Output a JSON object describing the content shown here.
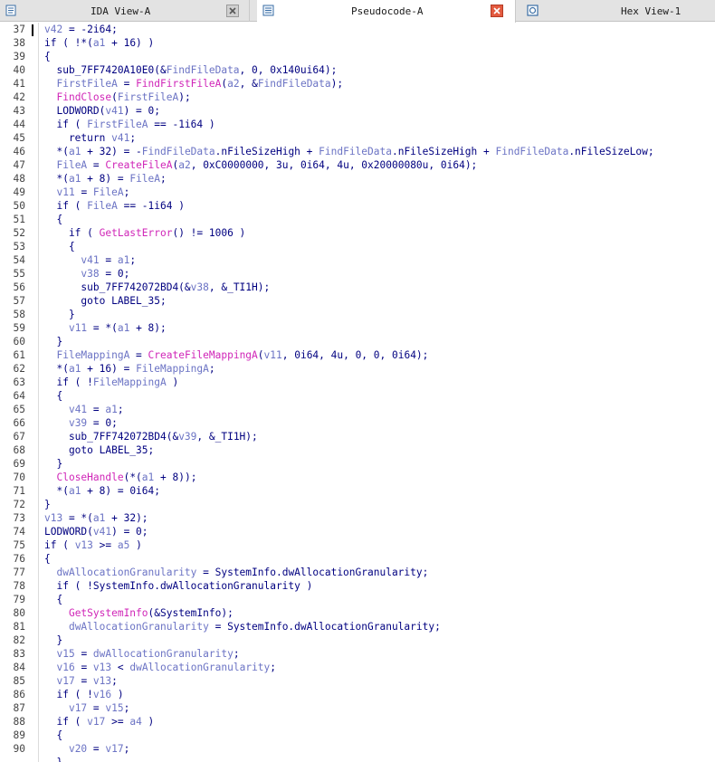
{
  "tabs": [
    {
      "id": "ida-view",
      "label": "IDA View-A",
      "icon": "ida-view-icon",
      "active": false
    },
    {
      "id": "pseudocode",
      "label": "Pseudocode-A",
      "icon": "pseudocode-icon",
      "active": true
    },
    {
      "id": "hex-view",
      "label": "Hex View-1",
      "icon": "hex-view-icon",
      "active": false
    }
  ],
  "colors": {
    "default": "#000080",
    "variable": "#6b73c4",
    "function": "#d026b8",
    "line_number": "#444444",
    "close_active": "#e35a3f"
  },
  "code_lines": [
    {
      "n": "37",
      "tokens": [
        [
          "v",
          "v42"
        ],
        [
          "o",
          " = -2i64;"
        ]
      ]
    },
    {
      "n": "38",
      "tokens": [
        [
          "o",
          "if ( !*("
        ],
        [
          "v",
          "a1"
        ],
        [
          "o",
          " + 16) )"
        ]
      ]
    },
    {
      "n": "39",
      "tokens": [
        [
          "o",
          "{"
        ]
      ]
    },
    {
      "n": "40",
      "tokens": [
        [
          "o",
          "  sub_7FF7420A10E0(&"
        ],
        [
          "v",
          "FindFileData"
        ],
        [
          "o",
          ", 0, 0x140ui64);"
        ]
      ]
    },
    {
      "n": "41",
      "tokens": [
        [
          "o",
          "  "
        ],
        [
          "v",
          "FirstFileA"
        ],
        [
          "o",
          " = "
        ],
        [
          "f",
          "FindFirstFileA"
        ],
        [
          "o",
          "("
        ],
        [
          "v",
          "a2"
        ],
        [
          "o",
          ", &"
        ],
        [
          "v",
          "FindFileData"
        ],
        [
          "o",
          ");"
        ]
      ]
    },
    {
      "n": "42",
      "tokens": [
        [
          "o",
          "  "
        ],
        [
          "f",
          "FindClose"
        ],
        [
          "o",
          "("
        ],
        [
          "v",
          "FirstFileA"
        ],
        [
          "o",
          ");"
        ]
      ]
    },
    {
      "n": "43",
      "tokens": [
        [
          "o",
          "  LODWORD("
        ],
        [
          "v",
          "v41"
        ],
        [
          "o",
          ") = 0;"
        ]
      ]
    },
    {
      "n": "44",
      "tokens": [
        [
          "o",
          "  if ( "
        ],
        [
          "v",
          "FirstFileA"
        ],
        [
          "o",
          " == -1i64 )"
        ]
      ]
    },
    {
      "n": "45",
      "tokens": [
        [
          "o",
          "    return "
        ],
        [
          "v",
          "v41"
        ],
        [
          "o",
          ";"
        ]
      ]
    },
    {
      "n": "46",
      "tokens": [
        [
          "o",
          "  *("
        ],
        [
          "v",
          "a1"
        ],
        [
          "o",
          " + 32) = -"
        ],
        [
          "v",
          "FindFileData"
        ],
        [
          "o",
          ".nFileSizeHigh + "
        ],
        [
          "v",
          "FindFileData"
        ],
        [
          "o",
          ".nFileSizeHigh + "
        ],
        [
          "v",
          "FindFileData"
        ],
        [
          "o",
          ".nFileSizeLow;"
        ]
      ]
    },
    {
      "n": "47",
      "tokens": [
        [
          "o",
          "  "
        ],
        [
          "v",
          "FileA"
        ],
        [
          "o",
          " = "
        ],
        [
          "f",
          "CreateFileA"
        ],
        [
          "o",
          "("
        ],
        [
          "v",
          "a2"
        ],
        [
          "o",
          ", 0xC0000000, 3u, 0i64, 4u, 0x20000080u, 0i64);"
        ]
      ]
    },
    {
      "n": "48",
      "tokens": [
        [
          "o",
          "  *("
        ],
        [
          "v",
          "a1"
        ],
        [
          "o",
          " + 8) = "
        ],
        [
          "v",
          "FileA"
        ],
        [
          "o",
          ";"
        ]
      ]
    },
    {
      "n": "49",
      "tokens": [
        [
          "o",
          "  "
        ],
        [
          "v",
          "v11"
        ],
        [
          "o",
          " = "
        ],
        [
          "v",
          "FileA"
        ],
        [
          "o",
          ";"
        ]
      ]
    },
    {
      "n": "50",
      "tokens": [
        [
          "o",
          "  if ( "
        ],
        [
          "v",
          "FileA"
        ],
        [
          "o",
          " == -1i64 )"
        ]
      ]
    },
    {
      "n": "51",
      "tokens": [
        [
          "o",
          "  {"
        ]
      ]
    },
    {
      "n": "52",
      "tokens": [
        [
          "o",
          "    if ( "
        ],
        [
          "f",
          "GetLastError"
        ],
        [
          "o",
          "() != 1006 )"
        ]
      ]
    },
    {
      "n": "53",
      "tokens": [
        [
          "o",
          "    {"
        ]
      ]
    },
    {
      "n": "54",
      "tokens": [
        [
          "o",
          "      "
        ],
        [
          "v",
          "v41"
        ],
        [
          "o",
          " = "
        ],
        [
          "v",
          "a1"
        ],
        [
          "o",
          ";"
        ]
      ]
    },
    {
      "n": "55",
      "tokens": [
        [
          "o",
          "      "
        ],
        [
          "v",
          "v38"
        ],
        [
          "o",
          " = 0;"
        ]
      ]
    },
    {
      "n": "56",
      "tokens": [
        [
          "o",
          "      sub_7FF742072BD4(&"
        ],
        [
          "v",
          "v38"
        ],
        [
          "o",
          ", &_TI1H);"
        ]
      ]
    },
    {
      "n": "57",
      "tokens": [
        [
          "o",
          "      goto LABEL_35;"
        ]
      ]
    },
    {
      "n": "58",
      "tokens": [
        [
          "o",
          "    }"
        ]
      ]
    },
    {
      "n": "59",
      "tokens": [
        [
          "o",
          "    "
        ],
        [
          "v",
          "v11"
        ],
        [
          "o",
          " = *("
        ],
        [
          "v",
          "a1"
        ],
        [
          "o",
          " + 8);"
        ]
      ]
    },
    {
      "n": "60",
      "tokens": [
        [
          "o",
          "  }"
        ]
      ]
    },
    {
      "n": "61",
      "tokens": [
        [
          "o",
          "  "
        ],
        [
          "v",
          "FileMappingA"
        ],
        [
          "o",
          " = "
        ],
        [
          "f",
          "CreateFileMappingA"
        ],
        [
          "o",
          "("
        ],
        [
          "v",
          "v11"
        ],
        [
          "o",
          ", 0i64, 4u, 0, 0, 0i64);"
        ]
      ]
    },
    {
      "n": "62",
      "tokens": [
        [
          "o",
          "  *("
        ],
        [
          "v",
          "a1"
        ],
        [
          "o",
          " + 16) = "
        ],
        [
          "v",
          "FileMappingA"
        ],
        [
          "o",
          ";"
        ]
      ]
    },
    {
      "n": "63",
      "tokens": [
        [
          "o",
          "  if ( !"
        ],
        [
          "v",
          "FileMappingA"
        ],
        [
          "o",
          " )"
        ]
      ]
    },
    {
      "n": "64",
      "tokens": [
        [
          "o",
          "  {"
        ]
      ]
    },
    {
      "n": "65",
      "tokens": [
        [
          "o",
          "    "
        ],
        [
          "v",
          "v41"
        ],
        [
          "o",
          " = "
        ],
        [
          "v",
          "a1"
        ],
        [
          "o",
          ";"
        ]
      ]
    },
    {
      "n": "66",
      "tokens": [
        [
          "o",
          "    "
        ],
        [
          "v",
          "v39"
        ],
        [
          "o",
          " = 0;"
        ]
      ]
    },
    {
      "n": "67",
      "tokens": [
        [
          "o",
          "    sub_7FF742072BD4(&"
        ],
        [
          "v",
          "v39"
        ],
        [
          "o",
          ", &_TI1H);"
        ]
      ]
    },
    {
      "n": "68",
      "tokens": [
        [
          "o",
          "    goto LABEL_35;"
        ]
      ]
    },
    {
      "n": "69",
      "tokens": [
        [
          "o",
          "  }"
        ]
      ]
    },
    {
      "n": "70",
      "tokens": [
        [
          "o",
          "  "
        ],
        [
          "f",
          "CloseHandle"
        ],
        [
          "o",
          "(*("
        ],
        [
          "v",
          "a1"
        ],
        [
          "o",
          " + 8));"
        ]
      ]
    },
    {
      "n": "71",
      "tokens": [
        [
          "o",
          "  *("
        ],
        [
          "v",
          "a1"
        ],
        [
          "o",
          " + 8) = 0i64;"
        ]
      ]
    },
    {
      "n": "72",
      "tokens": [
        [
          "o",
          "}"
        ]
      ]
    },
    {
      "n": "73",
      "tokens": [
        [
          "v",
          "v13"
        ],
        [
          "o",
          " = *("
        ],
        [
          "v",
          "a1"
        ],
        [
          "o",
          " + 32);"
        ]
      ]
    },
    {
      "n": "74",
      "tokens": [
        [
          "o",
          "LODWORD("
        ],
        [
          "v",
          "v41"
        ],
        [
          "o",
          ") = 0;"
        ]
      ]
    },
    {
      "n": "75",
      "tokens": [
        [
          "o",
          "if ( "
        ],
        [
          "v",
          "v13"
        ],
        [
          "o",
          " >= "
        ],
        [
          "v",
          "a5"
        ],
        [
          "o",
          " )"
        ]
      ]
    },
    {
      "n": "76",
      "tokens": [
        [
          "o",
          "{"
        ]
      ]
    },
    {
      "n": "77",
      "tokens": [
        [
          "o",
          "  "
        ],
        [
          "v",
          "dwAllocationGranularity"
        ],
        [
          "o",
          " = SystemInfo.dwAllocationGranularity;"
        ]
      ]
    },
    {
      "n": "78",
      "tokens": [
        [
          "o",
          "  if ( !SystemInfo.dwAllocationGranularity )"
        ]
      ]
    },
    {
      "n": "79",
      "tokens": [
        [
          "o",
          "  {"
        ]
      ]
    },
    {
      "n": "80",
      "tokens": [
        [
          "o",
          "    "
        ],
        [
          "f",
          "GetSystemInfo"
        ],
        [
          "o",
          "(&SystemInfo);"
        ]
      ]
    },
    {
      "n": "81",
      "tokens": [
        [
          "o",
          "    "
        ],
        [
          "v",
          "dwAllocationGranularity"
        ],
        [
          "o",
          " = SystemInfo.dwAllocationGranularity;"
        ]
      ]
    },
    {
      "n": "82",
      "tokens": [
        [
          "o",
          "  }"
        ]
      ]
    },
    {
      "n": "83",
      "tokens": [
        [
          "o",
          "  "
        ],
        [
          "v",
          "v15"
        ],
        [
          "o",
          " = "
        ],
        [
          "v",
          "dwAllocationGranularity"
        ],
        [
          "o",
          ";"
        ]
      ]
    },
    {
      "n": "84",
      "tokens": [
        [
          "o",
          "  "
        ],
        [
          "v",
          "v16"
        ],
        [
          "o",
          " = "
        ],
        [
          "v",
          "v13"
        ],
        [
          "o",
          " < "
        ],
        [
          "v",
          "dwAllocationGranularity"
        ],
        [
          "o",
          ";"
        ]
      ]
    },
    {
      "n": "85",
      "tokens": [
        [
          "o",
          "  "
        ],
        [
          "v",
          "v17"
        ],
        [
          "o",
          " = "
        ],
        [
          "v",
          "v13"
        ],
        [
          "o",
          ";"
        ]
      ]
    },
    {
      "n": "86",
      "tokens": [
        [
          "o",
          "  if ( !"
        ],
        [
          "v",
          "v16"
        ],
        [
          "o",
          " )"
        ]
      ]
    },
    {
      "n": "87",
      "tokens": [
        [
          "o",
          "    "
        ],
        [
          "v",
          "v17"
        ],
        [
          "o",
          " = "
        ],
        [
          "v",
          "v15"
        ],
        [
          "o",
          ";"
        ]
      ]
    },
    {
      "n": "88",
      "tokens": [
        [
          "o",
          "  if ( "
        ],
        [
          "v",
          "v17"
        ],
        [
          "o",
          " >= "
        ],
        [
          "v",
          "a4"
        ],
        [
          "o",
          " )"
        ]
      ]
    },
    {
      "n": "89",
      "tokens": [
        [
          "o",
          "  {"
        ]
      ]
    },
    {
      "n": "90",
      "tokens": [
        [
          "o",
          "    "
        ],
        [
          "v",
          "v20"
        ],
        [
          "o",
          " = "
        ],
        [
          "v",
          "v17"
        ],
        [
          "o",
          ";"
        ]
      ]
    },
    {
      "n": "",
      "tokens": [
        [
          "o",
          "  }"
        ]
      ]
    }
  ]
}
